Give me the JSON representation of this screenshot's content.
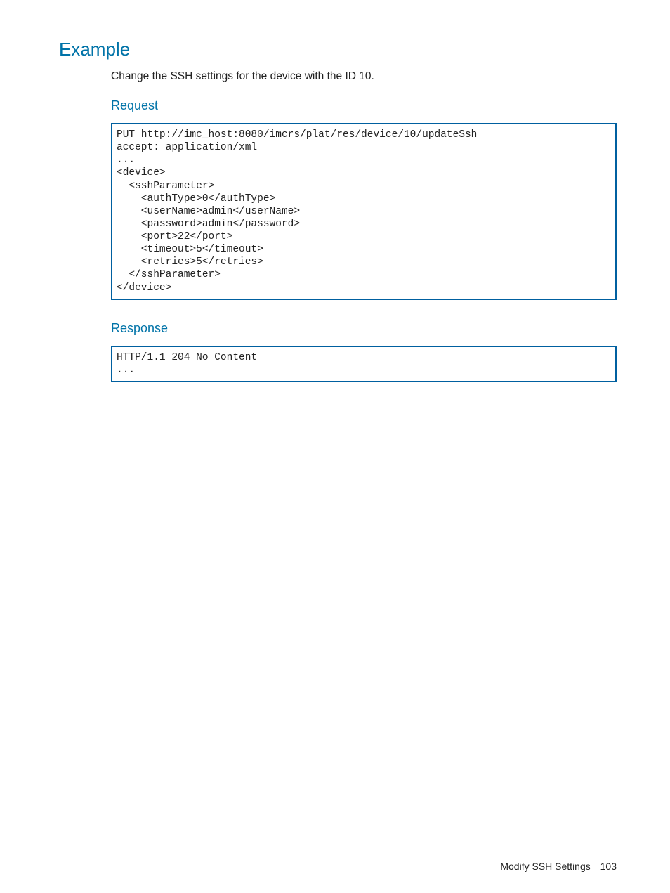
{
  "title": "Example",
  "intro": "Change the SSH settings for the device with the ID 10.",
  "request_heading": "Request",
  "request_code": "PUT http://imc_host:8080/imcrs/plat/res/device/10/updateSsh\naccept: application/xml\n...\n<device>\n  <sshParameter>\n    <authType>0</authType>\n    <userName>admin</userName>\n    <password>admin</password>\n    <port>22</port>\n    <timeout>5</timeout>\n    <retries>5</retries>\n  </sshParameter>\n</device>",
  "response_heading": "Response",
  "response_code": "HTTP/1.1 204 No Content\n...",
  "footer_label": "Modify SSH Settings",
  "footer_page": "103"
}
